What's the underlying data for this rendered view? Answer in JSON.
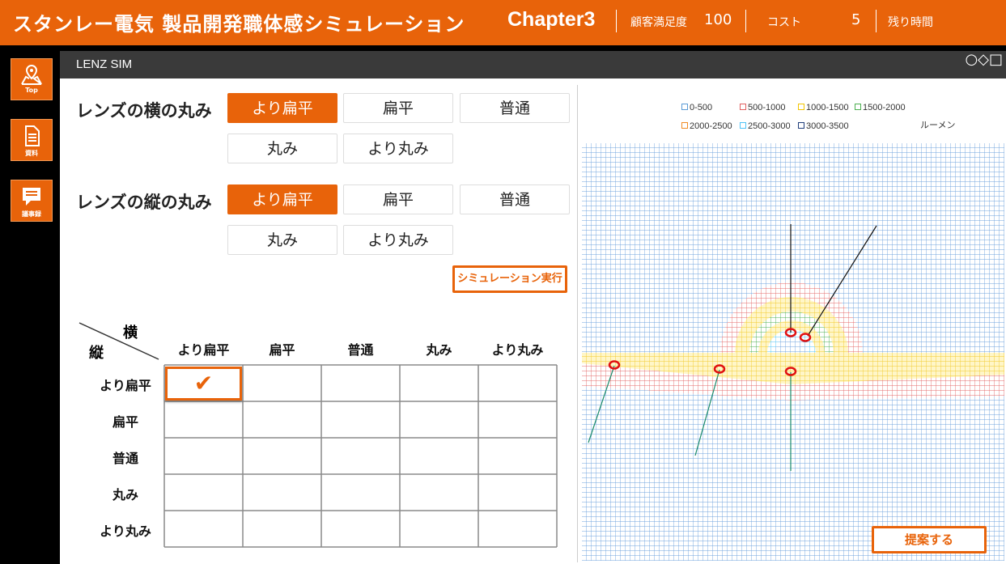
{
  "header": {
    "title": "スタンレー電気 製品開発職体感シミュレーション",
    "chapter": "Chapter3",
    "satisfaction_label": "顧客満足度",
    "satisfaction_value": "100",
    "cost_label": "コスト",
    "cost_value": "5",
    "time_label": "残り時間"
  },
  "sidebar": {
    "items": [
      {
        "label": "Top",
        "icon": "map-icon"
      },
      {
        "label": "資料",
        "icon": "document-icon"
      },
      {
        "label": "議事録",
        "icon": "chat-icon"
      }
    ]
  },
  "topbar": {
    "app_name": "LENZ SIM",
    "shapes": "○◇□"
  },
  "horizontal": {
    "label": "レンズの横の丸み",
    "options": [
      "より扁平",
      "扁平",
      "普通",
      "丸み",
      "より丸み"
    ],
    "selected": "より扁平"
  },
  "vertical": {
    "label": "レンズの縦の丸み",
    "options": [
      "より扁平",
      "扁平",
      "普通",
      "丸み",
      "より丸み"
    ],
    "selected": "より扁平"
  },
  "run_button": "シミュレーション実行",
  "matrix": {
    "corner_h": "横",
    "corner_v": "縦",
    "columns": [
      "より扁平",
      "扁平",
      "普通",
      "丸み",
      "より丸み"
    ],
    "rows": [
      "より扁平",
      "扁平",
      "普通",
      "丸み",
      "より丸み"
    ],
    "checked": "✔"
  },
  "legend": {
    "items": [
      {
        "label": "0-500",
        "color": "#5b9bd5"
      },
      {
        "label": "500-1000",
        "color": "#e06060"
      },
      {
        "label": "1000-1500",
        "color": "#f2c500"
      },
      {
        "label": "1500-2000",
        "color": "#4caf50"
      },
      {
        "label": "2000-2500",
        "color": "#f08a24"
      },
      {
        "label": "2500-3000",
        "color": "#4fc3f7"
      },
      {
        "label": "3000-3500",
        "color": "#1f3d7a"
      }
    ],
    "unit": "ルーメン"
  },
  "propose_button": "提案する"
}
